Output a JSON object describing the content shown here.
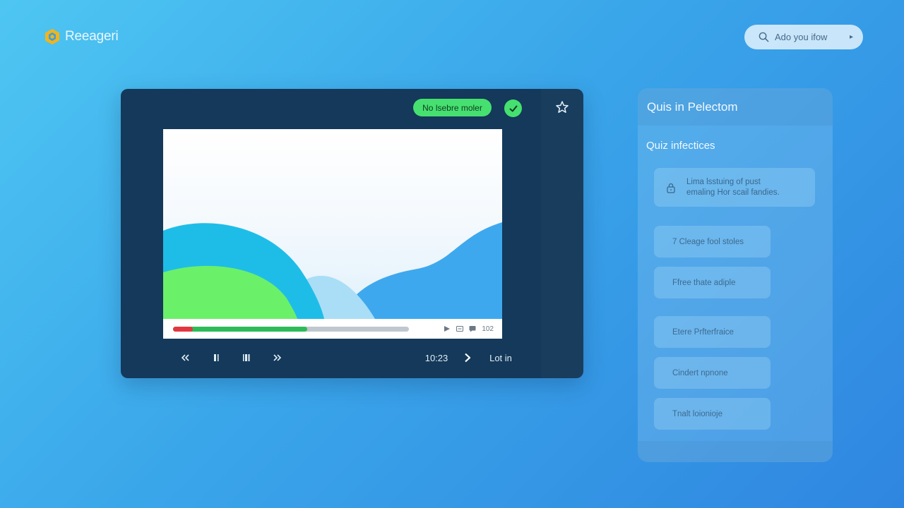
{
  "brand": {
    "name": "Reeageri",
    "logo_icon": "hexagon-logo-icon",
    "logo_color": "#f2b418"
  },
  "search": {
    "label": "Ado you ifow",
    "icon": "search-icon",
    "caret": "▸"
  },
  "player": {
    "status_chip": "No lsebre moler",
    "status_color": "#46e070",
    "check_icon": "check-icon",
    "star_icon": "star-icon",
    "progress_fraction": 0.57,
    "buffer_red_color": "#e3373f",
    "mini_controls": {
      "count": "102"
    },
    "controls": {
      "rewind_icon": "rewind-icon",
      "pause_icon": "pause-icon",
      "frame_icon": "frame-step-icon",
      "forward_icon": "fast-forward-icon",
      "time": "10:23",
      "next_icon": "chevron-right-icon",
      "action_label": "Lot in"
    }
  },
  "quiz": {
    "title": "Quis in Pelectom",
    "subtitle": "Quiz infectices",
    "info": {
      "icon": "lock-icon",
      "line1": "Lima lsstuing of pust",
      "line2": "emaling Hor scail fandies."
    },
    "options": [
      {
        "label": "7 Cleage fool stoles"
      },
      {
        "label": "Ffree thate adiple"
      },
      {
        "label": "Etere Prfterfraice"
      },
      {
        "label": "Cindert npnone"
      },
      {
        "label": "Tnalt loionioje"
      }
    ]
  }
}
